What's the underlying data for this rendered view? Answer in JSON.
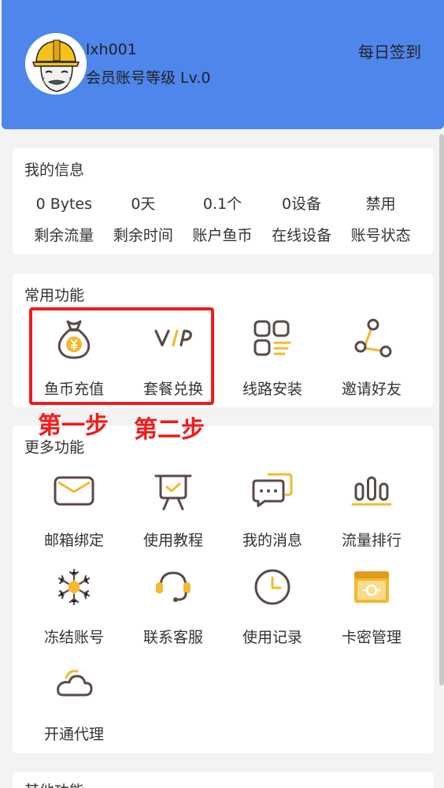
{
  "header": {
    "username": "lxh001",
    "level": "会员账号等级 Lv.0",
    "signin_label": "每日签到"
  },
  "info": {
    "title": "我的信息",
    "items": [
      {
        "value": "0 Bytes",
        "label": "剩余流量"
      },
      {
        "value": "0天",
        "label": "剩余时间"
      },
      {
        "value": "0.1个",
        "label": "账户鱼币"
      },
      {
        "value": "0设备",
        "label": "在线设备"
      },
      {
        "value": "禁用",
        "label": "账号状态"
      }
    ]
  },
  "common": {
    "title": "常用功能",
    "items": [
      {
        "label": "鱼币充值",
        "icon": "money-bag-icon"
      },
      {
        "label": "套餐兑换",
        "icon": "vip-icon"
      },
      {
        "label": "线路安装",
        "icon": "grid-icon"
      },
      {
        "label": "邀请好友",
        "icon": "share-icon"
      }
    ]
  },
  "annotations": {
    "step1": "第一步",
    "step2": "第二步"
  },
  "more": {
    "title": "更多功能",
    "items": [
      {
        "label": "邮箱绑定",
        "icon": "mail-icon"
      },
      {
        "label": "使用教程",
        "icon": "easel-icon"
      },
      {
        "label": "我的消息",
        "icon": "chat-icon"
      },
      {
        "label": "流量排行",
        "icon": "ranking-icon"
      },
      {
        "label": "冻结账号",
        "icon": "snowflake-icon"
      },
      {
        "label": "联系客服",
        "icon": "headset-icon"
      },
      {
        "label": "使用记录",
        "icon": "clock-icon"
      },
      {
        "label": "卡密管理",
        "icon": "card-key-icon"
      },
      {
        "label": "开通代理",
        "icon": "cloud-icon"
      }
    ]
  },
  "other": {
    "title": "其他功能"
  },
  "colors": {
    "header_bg": "#4f86ec",
    "accent": "#f5b82e",
    "icon_dark": "#5a4a4a",
    "annotation": "#f21b1b"
  }
}
